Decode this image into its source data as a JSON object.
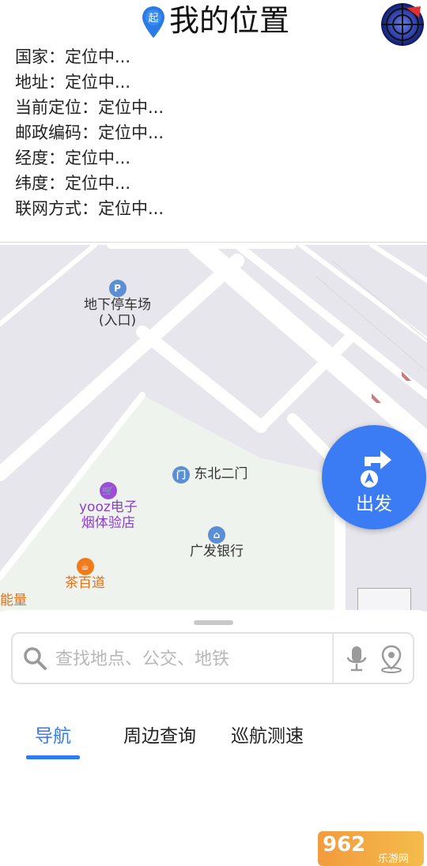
{
  "header": {
    "title": "我的位置",
    "pin_badge": "起"
  },
  "info_rows": [
    "国家：定位中...",
    "地址：定位中...",
    "当前定位：定位中...",
    "邮政编码：定位中...",
    "经度：定位中...",
    "纬度：定位中...",
    "联网方式：定位中..."
  ],
  "map": {
    "pois": {
      "parking": {
        "name": "地下停车场",
        "sub": "(入口)"
      },
      "gate": {
        "name": "东北二门"
      },
      "shop": {
        "name": "yooz电子",
        "sub": "烟体验店"
      },
      "bank": {
        "name": "广发银行"
      },
      "tea": {
        "name": "茶百道"
      },
      "energy": {
        "name": "能量"
      }
    },
    "go_button": "出发",
    "colors": {
      "road": "#ffffff",
      "block": "#e6e6ec",
      "park": "#eef3ee",
      "accent": "#3b7cf5",
      "orange": "#f07b18",
      "purple": "#8a3fc8"
    }
  },
  "search": {
    "placeholder": "查找地点、公交、地铁",
    "value": ""
  },
  "tabs": [
    {
      "label": "导航",
      "active": true
    },
    {
      "label": "周边查询",
      "active": false
    },
    {
      "label": "巡航测速",
      "active": false
    }
  ],
  "watermark": {
    "text": "962",
    "sub": "乐游网"
  }
}
